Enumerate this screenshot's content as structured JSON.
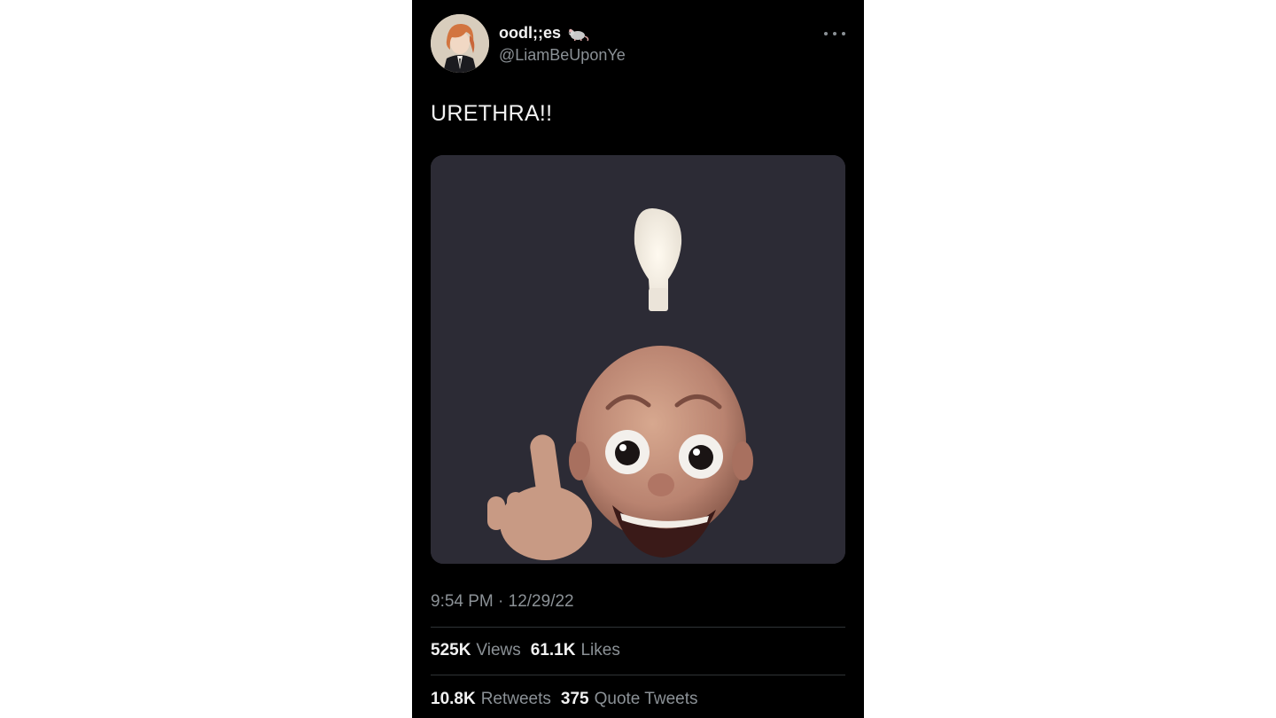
{
  "author": {
    "display_name": "oodl;;es",
    "name_emoji": "rat-icon",
    "handle": "@LiamBeUponYe"
  },
  "menu_icon": "more-horizontal-icon",
  "tweet": {
    "text": "URETHRA!!",
    "timestamp": "9:54 PM · 12/29/22",
    "media_description_icon": "lightbulb-idea-meme"
  },
  "stats_row_1": [
    {
      "value": "525K",
      "label": "Views"
    },
    {
      "value": "61.1K",
      "label": "Likes"
    }
  ],
  "stats_row_2": [
    {
      "value": "10.8K",
      "label": "Retweets"
    },
    {
      "value": "375",
      "label": "Quote Tweets"
    }
  ],
  "colors": {
    "background": "#000000",
    "primary_text": "#e7e9ea",
    "secondary_text": "#8b9196",
    "divider": "#2f3336"
  }
}
